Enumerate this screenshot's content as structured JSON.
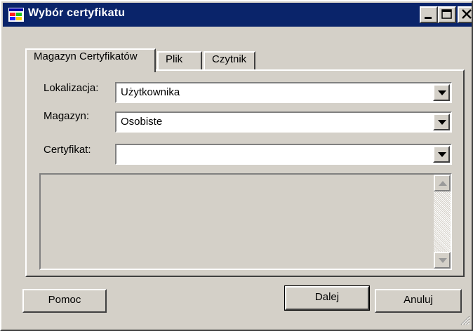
{
  "window": {
    "title": "Wybór certyfikatu",
    "icon": "app-window-icon",
    "controls": [
      "minimize-icon",
      "maximize-icon",
      "close-icon"
    ]
  },
  "tabs": [
    {
      "label": "Magazyn Certyfikatów",
      "active": true
    },
    {
      "label": "Plik",
      "active": false
    },
    {
      "label": "Czytnik",
      "active": false
    }
  ],
  "form": {
    "location_label": "Lokalizacja:",
    "location_value": "Użytkownika",
    "store_label": "Magazyn:",
    "store_value": "Osobiste",
    "certificate_label": "Certyfikat:",
    "certificate_value": ""
  },
  "buttons": {
    "help": "Pomoc",
    "next": "Dalej",
    "cancel": "Anuluj"
  },
  "colors": {
    "titlebar": "#0a246a",
    "face": "#d4d0c8"
  }
}
